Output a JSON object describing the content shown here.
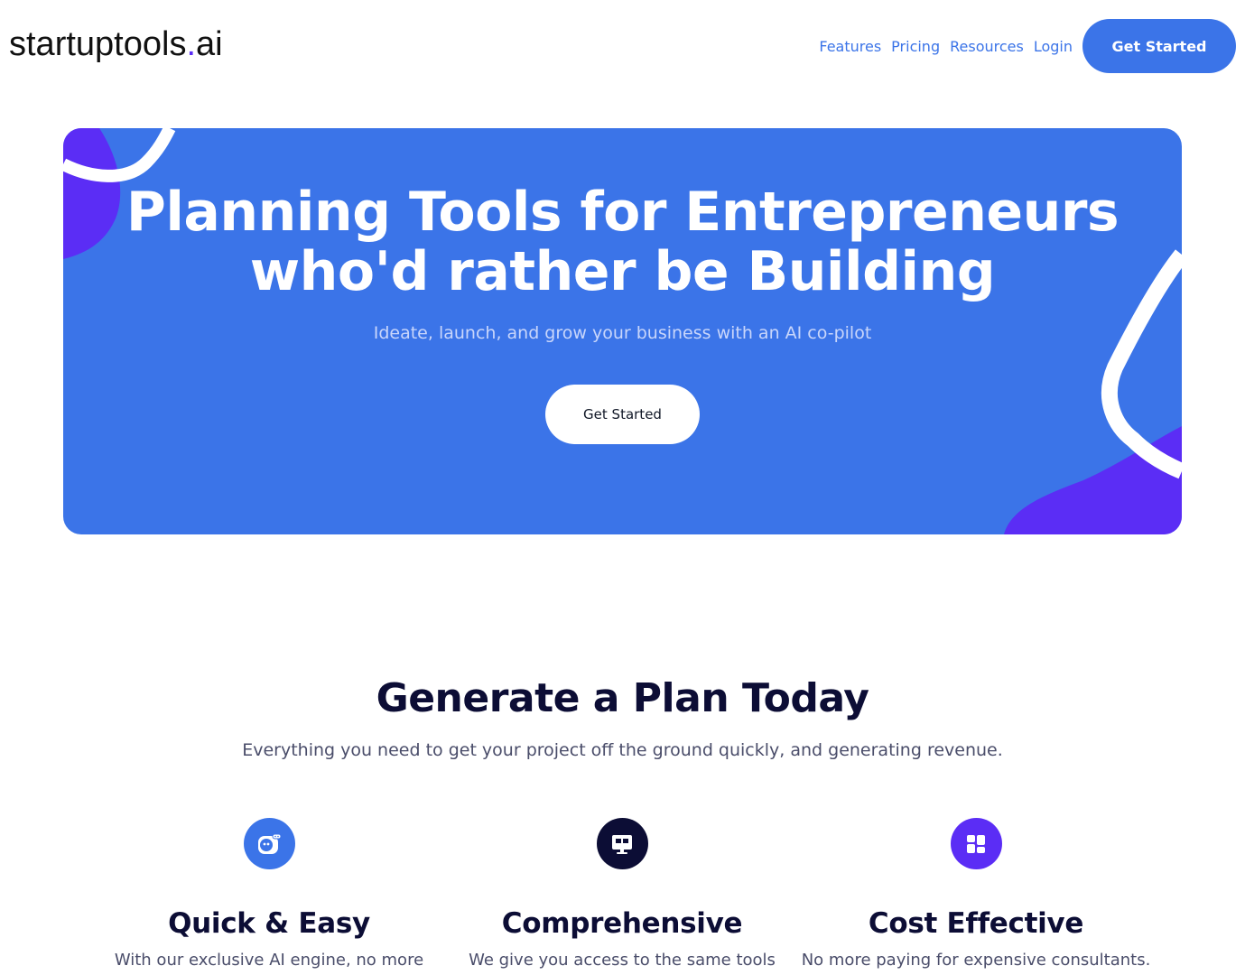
{
  "header": {
    "logo_main": "startuptools",
    "logo_dot": ".",
    "logo_tld": "ai",
    "nav": {
      "features": "Features",
      "pricing": "Pricing",
      "resources": "Resources",
      "login": "Login",
      "cta": "Get Started"
    }
  },
  "hero": {
    "title_line1": "Planning Tools for Entrepreneurs",
    "title_line2": "who'd rather be Building",
    "subtitle": "Ideate, launch, and grow your business with an AI co-pilot",
    "cta": "Get Started"
  },
  "section": {
    "title": "Generate a Plan Today",
    "subtitle": "Everything you need to get your project off the ground quickly, and generating revenue.",
    "features": [
      {
        "title": "Quick & Easy",
        "desc": "With our exclusive AI engine, no more",
        "icon": "robot-icon",
        "color": "#3b74e8"
      },
      {
        "title": "Comprehensive",
        "desc": "We give you access to the same tools",
        "icon": "monitor-icon",
        "color": "#0c0d35"
      },
      {
        "title": "Cost Effective",
        "desc": "No more paying for expensive consultants.",
        "icon": "dashboard-icon",
        "color": "#5b2df5"
      }
    ]
  },
  "colors": {
    "brand_blue": "#3b74e8",
    "accent_purple": "#5b2df5",
    "navy": "#0c0d35"
  }
}
